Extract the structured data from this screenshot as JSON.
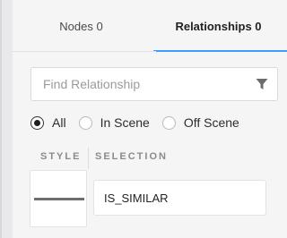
{
  "tabs": [
    {
      "label": "Nodes 0",
      "active": false
    },
    {
      "label": "Relationships 0",
      "active": true
    }
  ],
  "search": {
    "placeholder": "Find Relationship",
    "value": ""
  },
  "scope_filter": {
    "options": [
      {
        "label": "All",
        "checked": true
      },
      {
        "label": "In Scene",
        "checked": false
      },
      {
        "label": "Off Scene",
        "checked": false
      }
    ]
  },
  "columns": {
    "style_header": "STYLE",
    "selection_header": "SELECTION"
  },
  "relationships": [
    {
      "name": "IS_SIMILAR",
      "line_color": "#6e6e72"
    }
  ],
  "colors": {
    "accent": "#3aa0ff",
    "background": "#f5f5f6"
  },
  "icons": {
    "filter": "filter-funnel-icon"
  }
}
